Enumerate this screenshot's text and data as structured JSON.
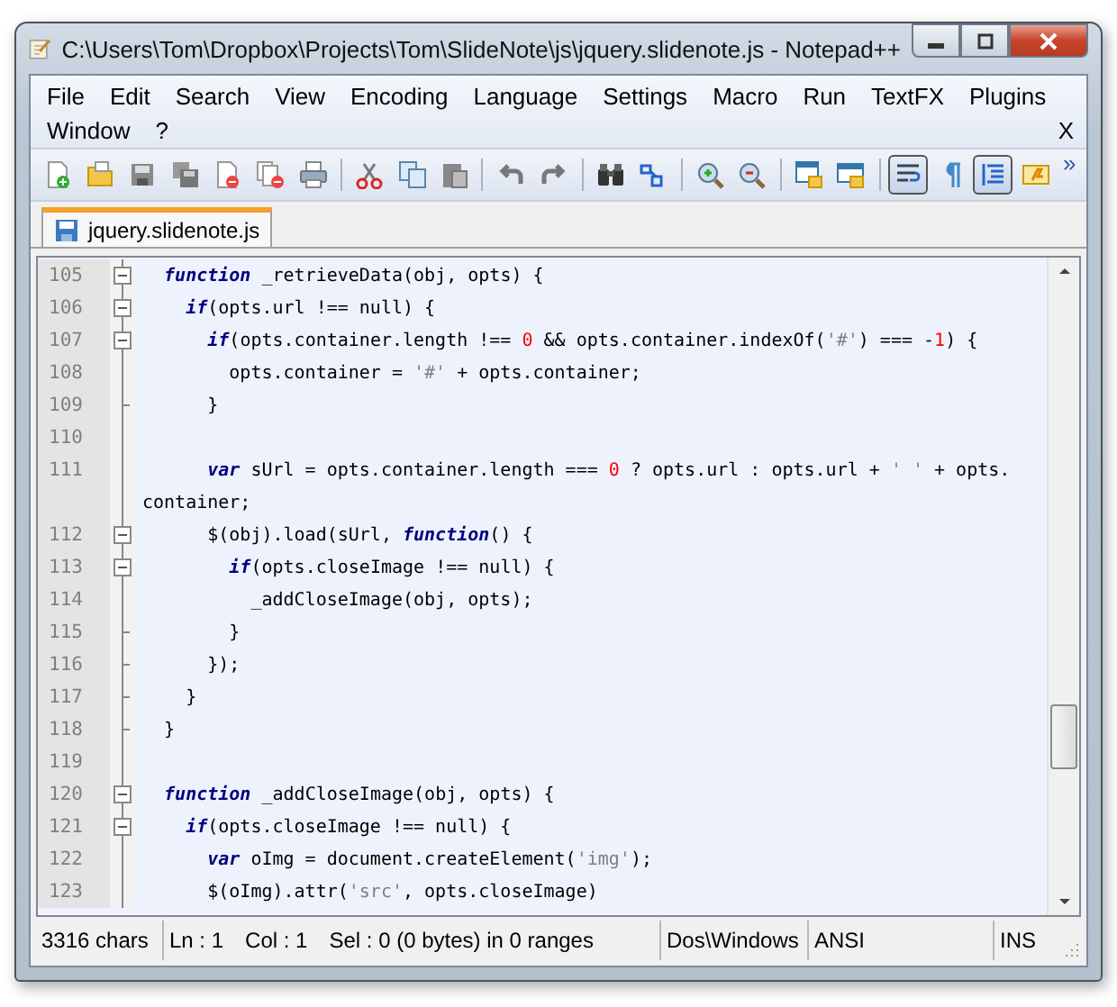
{
  "window": {
    "title": "C:\\Users\\Tom\\Dropbox\\Projects\\Tom\\SlideNote\\js\\jquery.slidenote.js - Notepad++"
  },
  "menu": [
    "File",
    "Edit",
    "Search",
    "View",
    "Encoding",
    "Language",
    "Settings",
    "Macro",
    "Run",
    "TextFX",
    "Plugins",
    "Window",
    "?"
  ],
  "menu_close": "X",
  "toolbar_buttons": [
    {
      "pressed": false
    },
    {
      "pressed": false
    },
    {
      "pressed": false
    },
    {
      "pressed": false
    },
    {
      "pressed": false
    },
    {
      "pressed": false
    },
    {
      "pressed": false
    },
    {
      "pressed": false
    },
    {
      "pressed": false
    },
    {
      "pressed": false
    },
    {
      "pressed": false
    },
    {
      "pressed": false
    },
    {
      "pressed": false
    },
    {
      "pressed": false
    },
    {
      "pressed": false
    },
    {
      "pressed": false
    },
    {
      "pressed": false
    },
    {
      "pressed": false
    },
    {
      "pressed": true
    },
    {
      "pressed": false
    },
    {
      "pressed": true
    },
    {
      "pressed": false
    }
  ],
  "toolbar_overflow": "»",
  "tabs": [
    {
      "label": "jquery.slidenote.js",
      "selected": true
    }
  ],
  "editor": {
    "lines": [
      {
        "number": "105",
        "kind": "fold-start",
        "tokens": [
          {
            "kind": "keyword",
            "t": "  function"
          },
          {
            "kind": "plain",
            "t": " _retrieveData(obj, opts) {"
          }
        ]
      },
      {
        "number": "106",
        "kind": "fold-start",
        "tokens": [
          {
            "kind": "keyword",
            "t": "    if"
          },
          {
            "kind": "plain",
            "t": "(opts.url !== null) {"
          }
        ]
      },
      {
        "number": "107",
        "kind": "fold-start",
        "tokens": [
          {
            "kind": "keyword",
            "t": "      if"
          },
          {
            "kind": "plain",
            "t": "(opts.container.length !== "
          },
          {
            "kind": "number",
            "t": "0"
          },
          {
            "kind": "plain",
            "t": " && opts.container.indexOf("
          },
          {
            "kind": "string",
            "t": "'#'"
          },
          {
            "kind": "plain",
            "t": ") === -"
          },
          {
            "kind": "number",
            "t": "1"
          },
          {
            "kind": "plain",
            "t": ") {"
          }
        ]
      },
      {
        "number": "108",
        "kind": "fold-body",
        "tokens": [
          {
            "kind": "plain",
            "t": "        opts.container = "
          },
          {
            "kind": "string",
            "t": "'#'"
          },
          {
            "kind": "plain",
            "t": " + opts.container;"
          }
        ]
      },
      {
        "number": "109",
        "kind": "fold-end",
        "tokens": [
          {
            "kind": "plain",
            "t": "      }"
          }
        ]
      },
      {
        "number": "110",
        "kind": "fold-body"
      },
      {
        "number": "111",
        "kind": "fold-body",
        "tokens": [
          {
            "kind": "keyword",
            "t": "      var"
          },
          {
            "kind": "plain",
            "t": " sUrl = opts.container.length === "
          },
          {
            "kind": "number",
            "t": "0"
          },
          {
            "kind": "plain",
            "t": " ? opts.url : opts.url + "
          },
          {
            "kind": "string",
            "t": "' '"
          },
          {
            "kind": "plain",
            "t": " + opts."
          }
        ]
      },
      {
        "kind": "fold-body",
        "tokens": [
          {
            "kind": "plain",
            "t": "container;"
          }
        ]
      },
      {
        "number": "112",
        "kind": "fold-start",
        "tokens": [
          {
            "kind": "plain",
            "t": "      $(obj).load(sUrl, "
          },
          {
            "kind": "keyword",
            "t": "function"
          },
          {
            "kind": "plain",
            "t": "() {"
          }
        ]
      },
      {
        "number": "113",
        "kind": "fold-start",
        "tokens": [
          {
            "kind": "keyword",
            "t": "        if"
          },
          {
            "kind": "plain",
            "t": "(opts.closeImage !== null) {"
          }
        ]
      },
      {
        "number": "114",
        "kind": "fold-body",
        "tokens": [
          {
            "kind": "plain",
            "t": "          _addCloseImage(obj, opts);"
          }
        ]
      },
      {
        "number": "115",
        "kind": "fold-end",
        "tokens": [
          {
            "kind": "plain",
            "t": "        }"
          }
        ]
      },
      {
        "number": "116",
        "kind": "fold-end",
        "tokens": [
          {
            "kind": "plain",
            "t": "      });"
          }
        ]
      },
      {
        "number": "117",
        "kind": "fold-end",
        "tokens": [
          {
            "kind": "plain",
            "t": "    }"
          }
        ]
      },
      {
        "number": "118",
        "kind": "fold-end",
        "tokens": [
          {
            "kind": "plain",
            "t": "  }"
          }
        ]
      },
      {
        "number": "119",
        "kind": "fold-body"
      },
      {
        "number": "120",
        "kind": "fold-start",
        "tokens": [
          {
            "kind": "keyword",
            "t": "  function"
          },
          {
            "kind": "plain",
            "t": " _addCloseImage(obj, opts) {"
          }
        ]
      },
      {
        "number": "121",
        "kind": "fold-start",
        "tokens": [
          {
            "kind": "keyword",
            "t": "    if"
          },
          {
            "kind": "plain",
            "t": "(opts.closeImage !== null) {"
          }
        ]
      },
      {
        "number": "122",
        "kind": "fold-body",
        "tokens": [
          {
            "kind": "keyword",
            "t": "      var"
          },
          {
            "kind": "plain",
            "t": " oImg = document.createElement("
          },
          {
            "kind": "string",
            "t": "'img'"
          },
          {
            "kind": "plain",
            "t": ");"
          }
        ]
      },
      {
        "number": "123",
        "kind": "fold-body",
        "tokens": [
          {
            "kind": "plain",
            "t": "      $(oImg).attr("
          },
          {
            "kind": "string",
            "t": "'src'"
          },
          {
            "kind": "plain",
            "t": ", opts.closeImage)"
          }
        ]
      }
    ]
  },
  "status_bar": {
    "chars": "3316 chars",
    "line": "Ln : 1",
    "column": "Col : 1",
    "selection": "Sel : 0 (0 bytes) in 0 ranges",
    "eol": "Dos\\Windows",
    "encoding": "ANSI",
    "mode": "INS"
  }
}
